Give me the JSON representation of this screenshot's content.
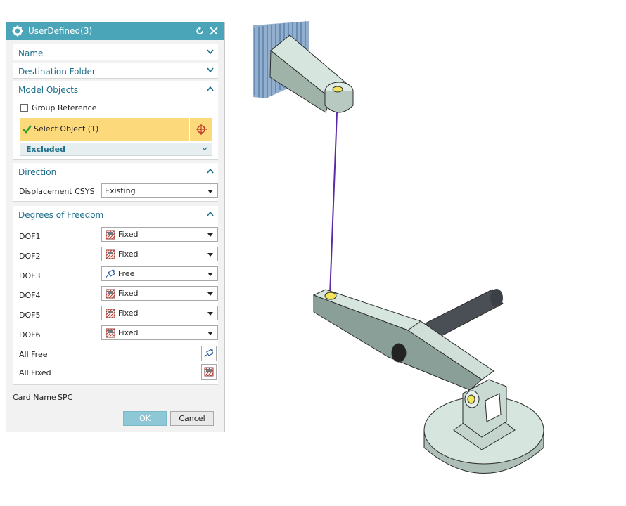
{
  "dialog": {
    "title": "UserDefined(3)",
    "icons": {
      "settings": "gear-icon",
      "reset": "reset-icon",
      "close": "close-icon"
    },
    "sections": {
      "name": {
        "label": "Name"
      },
      "destination": {
        "label": "Destination Folder"
      },
      "model_objects": {
        "label": "Model Objects",
        "group_reference": "Group Reference",
        "select_object": "Select Object (1)",
        "excluded": "Excluded"
      },
      "direction": {
        "label": "Direction",
        "displacement_label": "Displacement CSYS",
        "displacement_value": "Existing"
      },
      "dof": {
        "label": "Degrees of Freedom",
        "rows": [
          {
            "label": "DOF1",
            "value": "Fixed"
          },
          {
            "label": "DOF2",
            "value": "Fixed"
          },
          {
            "label": "DOF3",
            "value": "Free"
          },
          {
            "label": "DOF4",
            "value": "Fixed"
          },
          {
            "label": "DOF5",
            "value": "Fixed"
          },
          {
            "label": "DOF6",
            "value": "Fixed"
          }
        ],
        "all_free": "All Free",
        "all_fixed": "All Fixed"
      }
    },
    "card_name_label": "Card Name",
    "card_name_value": "SPC",
    "ok": "OK",
    "cancel": "Cancel"
  },
  "colors": {
    "titlebar": "#4aa5b8",
    "section_header": "#1d6e8a",
    "selection": "#fcd97a",
    "model_body": "#c9ded5",
    "constraint": "#3a6ea5"
  }
}
